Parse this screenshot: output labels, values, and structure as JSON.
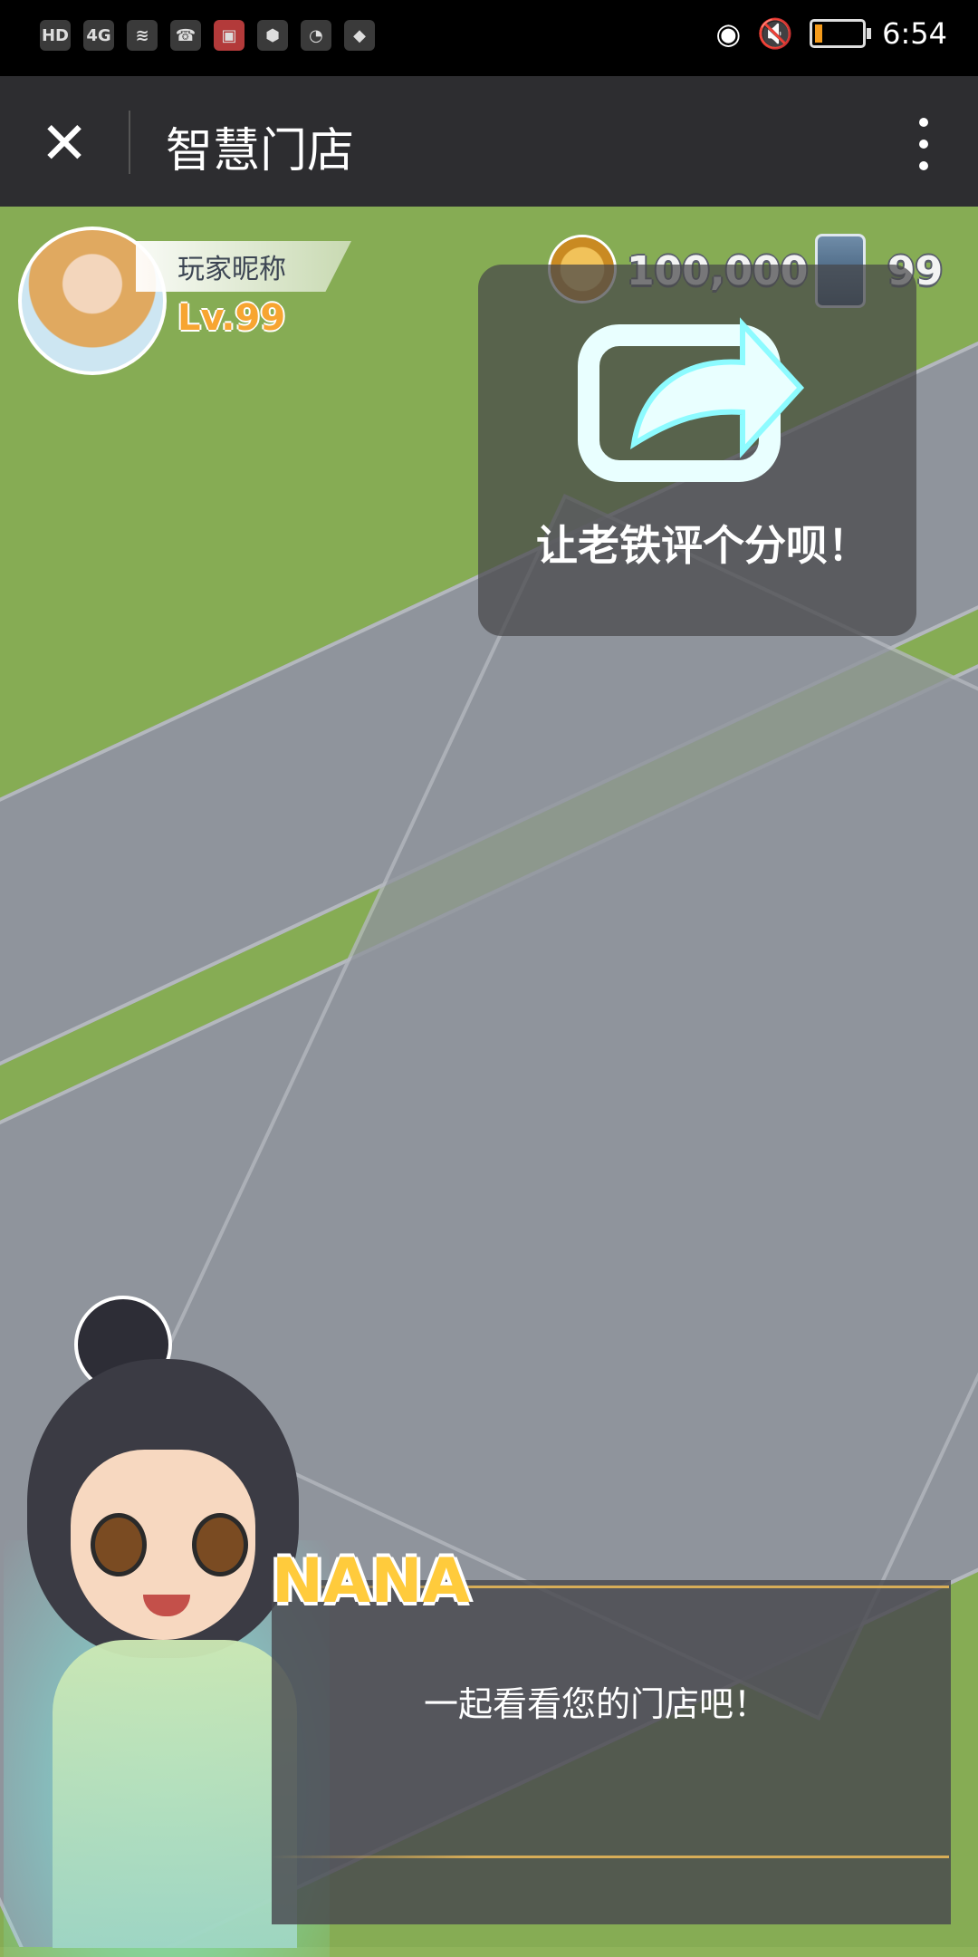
{
  "status_bar": {
    "left_icons": [
      "HD",
      "4G",
      "wifi-icon",
      "missed-call-icon",
      "app-icon",
      "app-icon",
      "app-icon",
      "app-icon"
    ],
    "time": "6:54"
  },
  "app_bar": {
    "title": "智慧门店"
  },
  "player": {
    "name": "玩家昵称",
    "level": "Lv.99",
    "coins": "100,000",
    "energy": "99"
  },
  "share": {
    "text": "让老铁评个分呗！"
  },
  "dialog": {
    "speaker": "NANA",
    "text": "一起看看您的门店吧！"
  },
  "colors": {
    "status_bar": "#000000",
    "app_bar": "#2d2d30",
    "grass": "#8cb45a",
    "road": "#8f949c",
    "gold": "#d7ad58",
    "level": "#f7a531",
    "speaker": "#ffcb3c"
  }
}
